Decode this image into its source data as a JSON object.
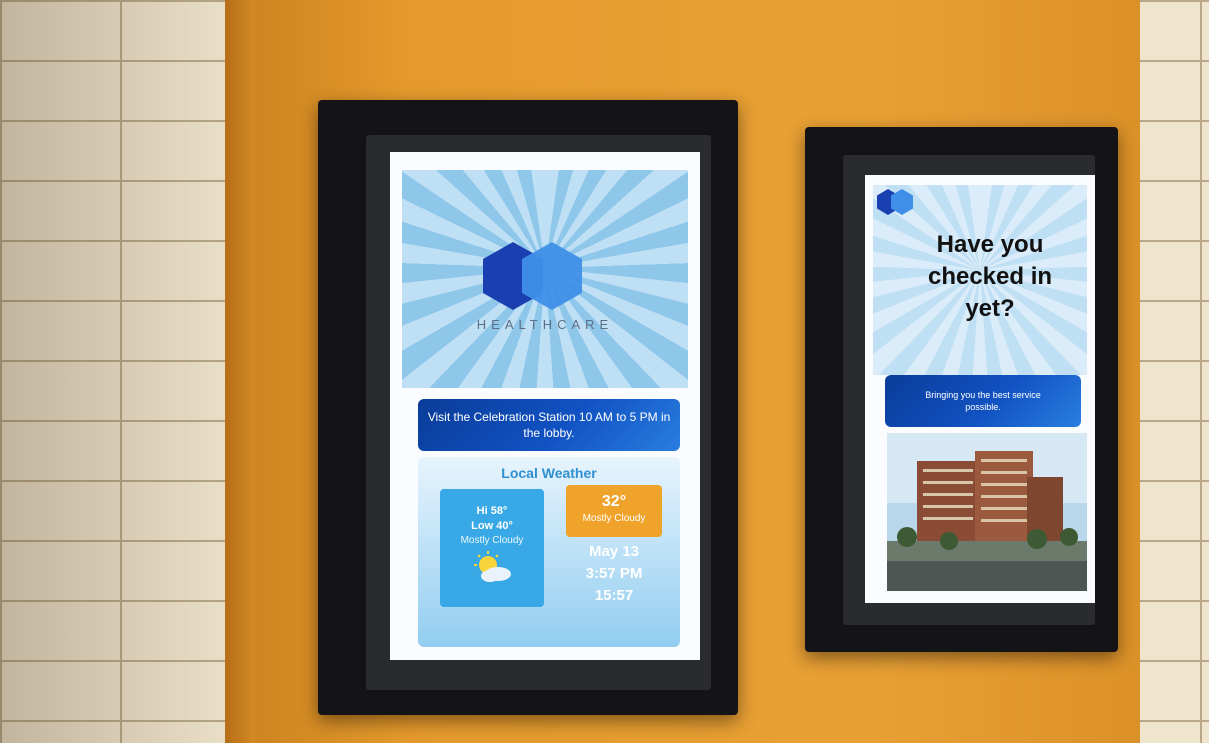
{
  "left_screen": {
    "logo_text": "HEALTHCARE",
    "banner_text": "Visit the Celebration Station 10 AM to 5 PM in the lobby.",
    "weather_title": "Local Weather",
    "forecast": {
      "hi": "Hi 58°",
      "low": "Low 40°",
      "condition": "Mostly Cloudy"
    },
    "current": {
      "temp": "32°",
      "condition": "Mostly Cloudy"
    },
    "date": "May 13",
    "time_12h": "3:57 PM",
    "time_24h": "15:57"
  },
  "right_screen": {
    "headline_line1": "Have you",
    "headline_line2": "checked in",
    "headline_line3": "yet?",
    "tagline": "Bringing you the best service possible."
  },
  "colors": {
    "wall_panel": "#e59a2c",
    "banner_blue": "#1152c2",
    "forecast_box": "#38a9e6",
    "current_box": "#f0a32a"
  },
  "icons": [
    "logo-hex-icon",
    "partly-cloudy-icon",
    "hospital-building-photo"
  ]
}
